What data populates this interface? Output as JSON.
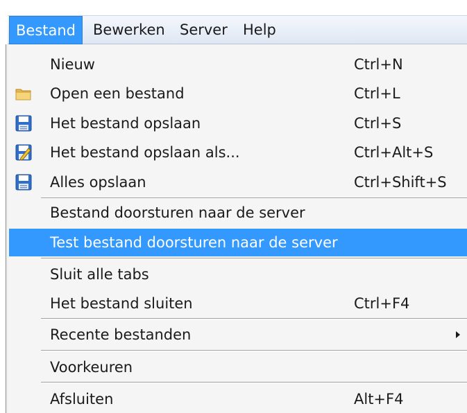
{
  "menubar": {
    "items": [
      {
        "label": "Bestand",
        "active": true
      },
      {
        "label": "Bewerken"
      },
      {
        "label": "Server"
      },
      {
        "label": "Help"
      }
    ]
  },
  "menu": {
    "items": [
      {
        "label": "Nieuw",
        "shortcut": "Ctrl+N"
      },
      {
        "label": "Open een bestand",
        "shortcut": "Ctrl+L",
        "icon": "folder-icon"
      },
      {
        "label": "Het bestand opslaan",
        "shortcut": "Ctrl+S",
        "icon": "save-icon"
      },
      {
        "label": "Het bestand opslaan als...",
        "shortcut": "Ctrl+Alt+S",
        "icon": "save-as-icon"
      },
      {
        "label": "Alles opslaan",
        "shortcut": "Ctrl+Shift+S",
        "icon": "save-all-icon"
      },
      {
        "label": "Bestand doorsturen naar de server"
      },
      {
        "label": "Test bestand doorsturen naar de server",
        "highlighted": true
      },
      {
        "label": "Sluit alle tabs"
      },
      {
        "label": "Het bestand sluiten",
        "shortcut": "Ctrl+F4"
      },
      {
        "label": "Recente bestanden",
        "submenu": true
      },
      {
        "label": "Voorkeuren"
      },
      {
        "label": "Afsluiten",
        "shortcut": "Alt+F4"
      }
    ]
  },
  "colors": {
    "highlight": "#3399ff",
    "menu_background": "#f5f5f5",
    "menubar_background": "#dfe7f3"
  }
}
